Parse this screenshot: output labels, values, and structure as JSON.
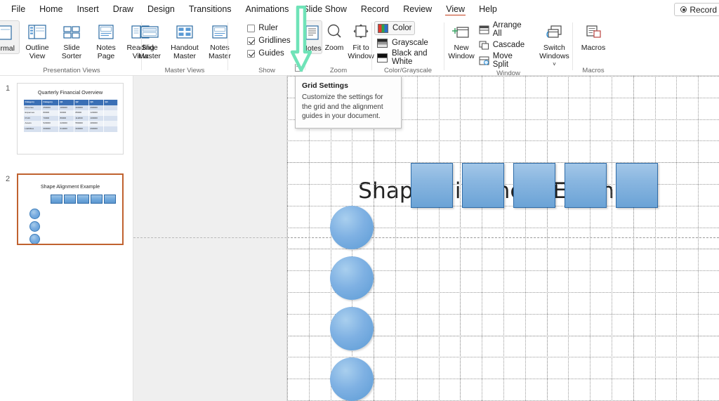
{
  "menu": {
    "items": [
      {
        "label": "File",
        "active": false
      },
      {
        "label": "Home",
        "active": false
      },
      {
        "label": "Insert",
        "active": false
      },
      {
        "label": "Draw",
        "active": false
      },
      {
        "label": "Design",
        "active": false
      },
      {
        "label": "Transitions",
        "active": false
      },
      {
        "label": "Animations",
        "active": false
      },
      {
        "label": "Slide Show",
        "active": false
      },
      {
        "label": "Record",
        "active": false
      },
      {
        "label": "Review",
        "active": false
      },
      {
        "label": "View",
        "active": true
      },
      {
        "label": "Help",
        "active": false
      }
    ],
    "record_button": "Record"
  },
  "ribbon": {
    "groups": [
      {
        "label": "Presentation Views"
      },
      {
        "label": "Master Views"
      },
      {
        "label": "Show"
      },
      {
        "label": "Zoom"
      },
      {
        "label": "Color/Grayscale"
      },
      {
        "label": "Window"
      },
      {
        "label": "Macros"
      }
    ],
    "presentation_views": [
      {
        "label1": "Normal",
        "label2": "",
        "selected": true
      },
      {
        "label1": "Outline",
        "label2": "View",
        "selected": false
      },
      {
        "label1": "Slide",
        "label2": "Sorter",
        "selected": false
      },
      {
        "label1": "Notes",
        "label2": "Page",
        "selected": false
      },
      {
        "label1": "Reading",
        "label2": "View",
        "selected": false
      }
    ],
    "master_views": [
      {
        "label1": "Slide",
        "label2": "Master"
      },
      {
        "label1": "Handout",
        "label2": "Master"
      },
      {
        "label1": "Notes",
        "label2": "Master"
      }
    ],
    "show": [
      {
        "label": "Ruler",
        "checked": false
      },
      {
        "label": "Gridlines",
        "checked": true
      },
      {
        "label": "Guides",
        "checked": true
      }
    ],
    "zoom": [
      {
        "label1": "Notes",
        "label2": ""
      },
      {
        "label1": "Zoom",
        "label2": ""
      },
      {
        "label1": "Fit to",
        "label2": "Window"
      }
    ],
    "color_grayscale": [
      {
        "label": "Color",
        "selected": true
      },
      {
        "label": "Grayscale",
        "selected": false
      },
      {
        "label": "Black and White",
        "selected": false
      }
    ],
    "window": {
      "new_window_l1": "New",
      "new_window_l2": "Window",
      "items": [
        "Arrange All",
        "Cascade",
        "Move Split"
      ],
      "switch_l1": "Switch",
      "switch_l2": "Windows"
    },
    "macros": {
      "label1": "Macros",
      "label2": ""
    }
  },
  "tooltip": {
    "title": "Grid Settings",
    "body": "Customize the settings for the grid and the alignment guides in your document."
  },
  "thumbnails": [
    {
      "number": "1",
      "selected": false,
      "title": "Quarterly Financial Overview",
      "table": {
        "headers": [
          "Category",
          "Category",
          "Q1",
          "Q2",
          "Q3",
          "Q4"
        ],
        "rows": [
          [
            "Revenue",
            "250000",
            "180000",
            "320000",
            "290000"
          ],
          [
            "Expenses",
            "80000",
            "90000",
            "85000",
            "120000"
          ],
          [
            "Profit",
            "70000",
            "86000",
            "112000",
            "100000"
          ],
          [
            "Assets",
            "520000",
            "220000",
            "550000",
            "480000"
          ],
          [
            "Liabilities",
            "300000",
            "314000",
            "320000",
            "290000"
          ]
        ]
      }
    },
    {
      "number": "2",
      "selected": true,
      "title": "Shape Alignment Example",
      "rect_count": 5,
      "circle_count": 4
    }
  ],
  "slide": {
    "title": "Shape Alignment Example",
    "rect_count": 5,
    "circle_count": 4,
    "shape_fill": "#5B9BD5",
    "shape_outline": "#2F6CA8"
  },
  "annotation": {
    "arrow_color": "#6FE3B8",
    "arrow_target": "Show group dialog launcher"
  },
  "theme": {
    "accent": "#c43e1c",
    "selection_border": "#C0622F",
    "canvas_bg": "#efefef"
  }
}
